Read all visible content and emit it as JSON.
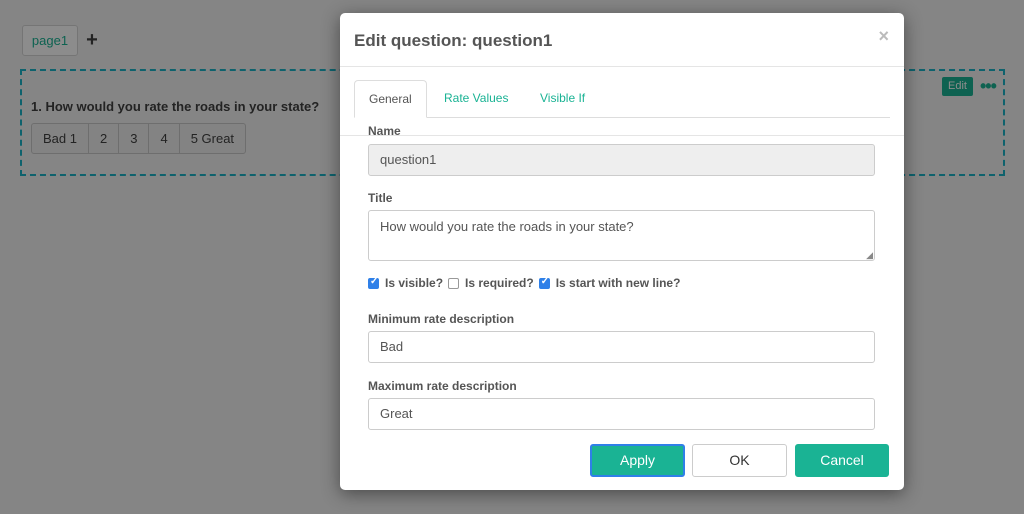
{
  "editor": {
    "page_tab": "page1",
    "add_page_icon": "+",
    "question_title": "1. How would you rate the roads in your state?",
    "rate_items": [
      "Bad 1",
      "2",
      "3",
      "4",
      "5 Great"
    ],
    "edit_label": "Edit",
    "more_icon": "•••"
  },
  "modal": {
    "title": "Edit question: question1",
    "close_icon": "×",
    "tabs": [
      {
        "label": "General"
      },
      {
        "label": "Rate Values"
      },
      {
        "label": "Visible If"
      }
    ],
    "fields": {
      "name_label": "Name",
      "name_value": "question1",
      "title_label": "Title",
      "title_value": "How would you rate the roads in your state?",
      "visible_label": "Is visible?",
      "required_label": "Is required?",
      "newline_label": "Is start with new line?",
      "min_label": "Minimum rate description",
      "min_value": "Bad",
      "max_label": "Maximum rate description",
      "max_value": "Great"
    },
    "checks": {
      "visible": true,
      "required": false,
      "newline": true
    },
    "buttons": {
      "apply": "Apply",
      "ok": "OK",
      "cancel": "Cancel"
    }
  },
  "colors": {
    "accent": "#1ab394",
    "focus": "#2f80e8"
  }
}
